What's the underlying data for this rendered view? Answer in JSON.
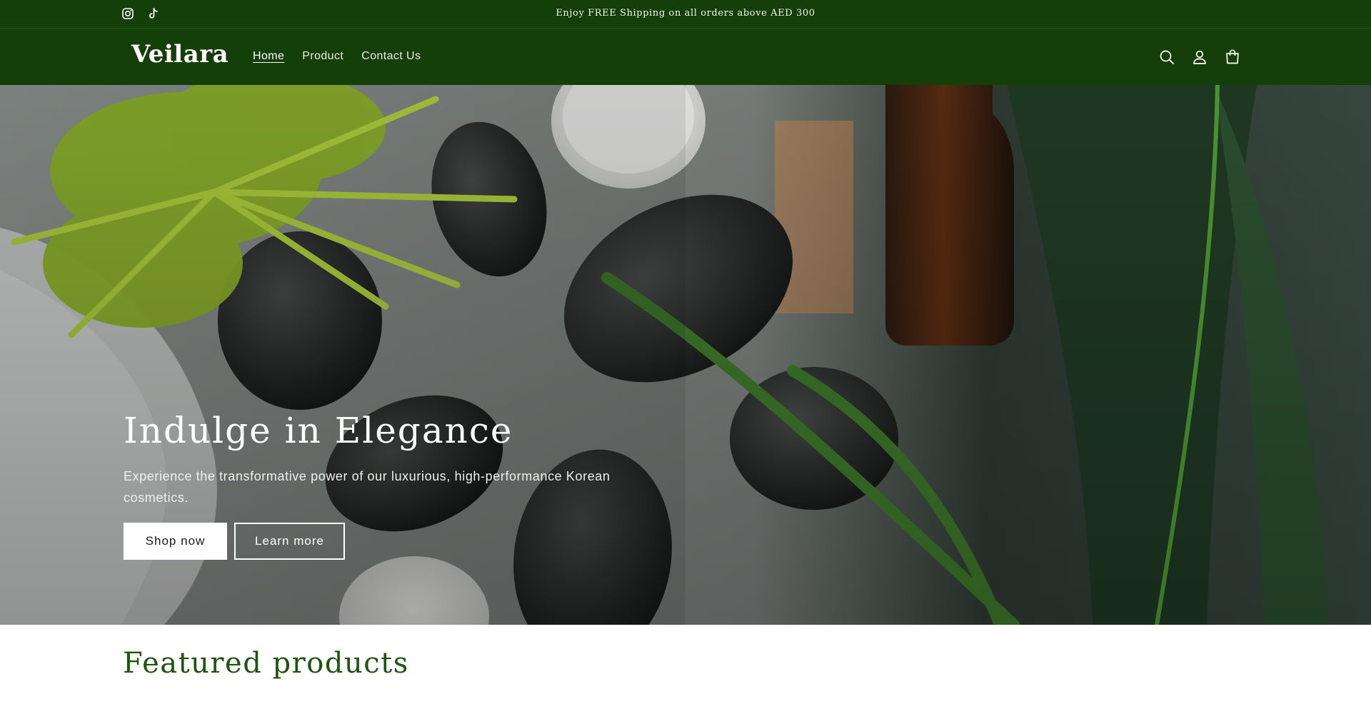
{
  "announcement": {
    "text": "Enjoy FREE Shipping on all orders above AED 300",
    "social_icons": [
      "instagram-icon",
      "tiktok-icon"
    ]
  },
  "header": {
    "logo": "Veilara",
    "nav": [
      {
        "label": "Home",
        "active": true
      },
      {
        "label": "Product",
        "active": false
      },
      {
        "label": "Contact Us",
        "active": false
      }
    ],
    "icons": [
      "search-icon",
      "account-icon",
      "cart-icon"
    ]
  },
  "hero": {
    "title": "Indulge in Elegance",
    "subtitle": "Experience the transformative power of our luxurious, high-performance Korean cosmetics.",
    "primary_button": "Shop now",
    "secondary_button": "Learn more"
  },
  "featured": {
    "title": "Featured products"
  },
  "colors": {
    "brand_green": "#143f09",
    "heading_green": "#1d5411",
    "white": "#ffffff"
  }
}
